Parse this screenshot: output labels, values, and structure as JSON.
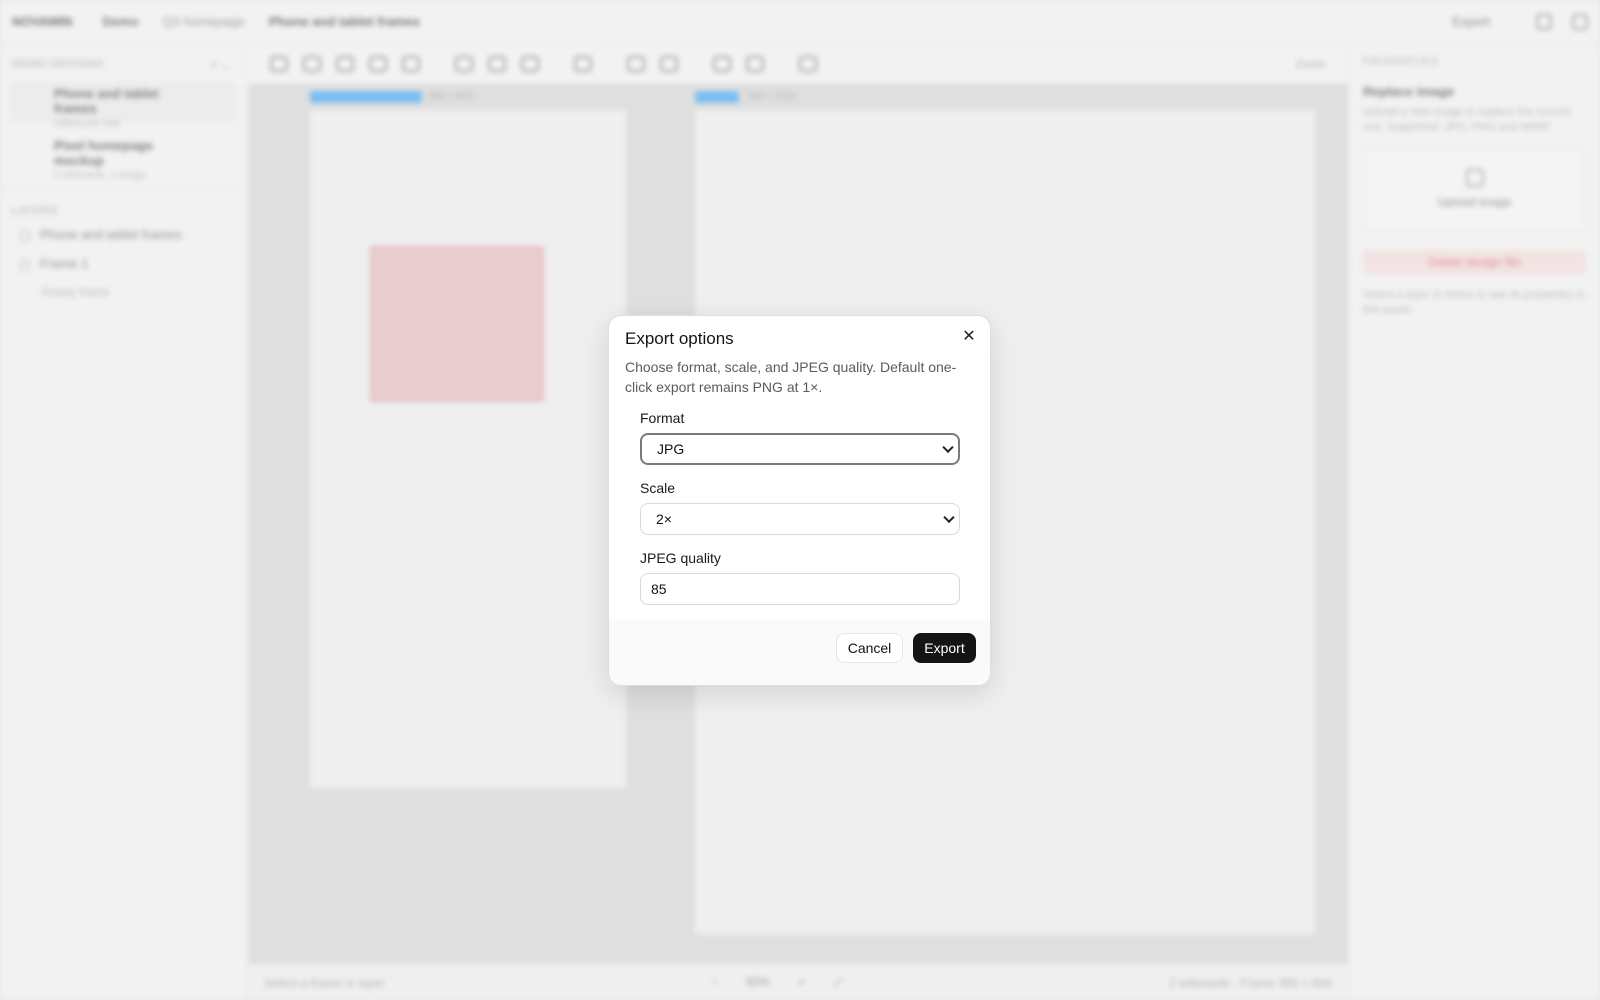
{
  "app": {
    "brand": "NOVAMIN",
    "breadcrumbs": [
      "Demo",
      "Q3 homepage"
    ],
    "current_design": "Phone and tablet frames",
    "share_label": "Export"
  },
  "left_panel": {
    "designs_title": "Demo designs",
    "designs": [
      {
        "title": "Phone and tablet frames",
        "subtitle": "edited just now",
        "active": true
      },
      {
        "title": "Pixel homepage mockup",
        "subtitle": "2 artboards, 1 image",
        "active": false
      }
    ],
    "layers_title": "Layers",
    "layers": [
      {
        "label": "Phone and tablet frames",
        "sub": false
      },
      {
        "label": "Frame 1",
        "sub": false
      },
      {
        "label": "Empty frame",
        "sub": true
      }
    ]
  },
  "toolbar": {
    "zoom": "Zoom"
  },
  "canvas": {
    "frame1_tag": "390 × 844",
    "frame2_tag": "768 × 1024"
  },
  "statusbar": {
    "left": "Select a frame or layer",
    "zoom": "60%",
    "right": "2 artboards · Frame 390 × 844"
  },
  "right_panel": {
    "title": "Properties",
    "heading": "Replace image",
    "description": "Upload a new image to replace the current one. Supported: JPG, PNG and WebP.",
    "upload_label": "Upload image",
    "danger_label": "Delete design file",
    "hint": "Select a layer or frame to see its properties in this panel."
  },
  "dialog": {
    "title": "Export options",
    "close_icon": "close-icon",
    "description": "Choose format, scale, and JPEG quality. Default one-click export remains PNG at 1×.",
    "format_label": "Format",
    "format_value": "JPG",
    "scale_label": "Scale",
    "scale_value": "2×",
    "quality_label": "JPEG quality",
    "quality_value": "85",
    "cancel_label": "Cancel",
    "export_label": "Export"
  },
  "colors": {
    "accent_blue": "#2a9df4",
    "selection_pink": "#e8b9bd",
    "primary_button": "#141414"
  }
}
